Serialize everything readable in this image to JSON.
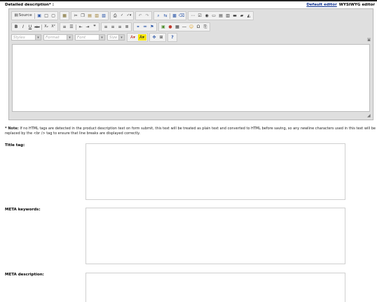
{
  "header": {
    "detailed_label": "Detailed description* :",
    "default_editor": "Default editor",
    "wysiwyg_editor": "WYSIWYG editor"
  },
  "toolbar": {
    "source_label": "Source",
    "styles_placeholder": "Styles",
    "format_placeholder": "Format",
    "font_placeholder": "Font",
    "size_placeholder": "Size",
    "bold": "B",
    "italic": "I",
    "underline": "U",
    "strike": "abc",
    "subscript": "X₂",
    "superscript": "X²",
    "help": "?"
  },
  "note": {
    "prefix": "* Note:",
    "text": " If no HTML tags are detected in the product description text on form submit, this text will be treated as plain text and converted to HTML before saving, so any newline characters used in this text will be replaced by the <br /> tag to ensure that line breaks are displayed correctly."
  },
  "fields": {
    "title_label": "Title tag:",
    "keywords_label": "META keywords:",
    "description_label": "META description:"
  }
}
